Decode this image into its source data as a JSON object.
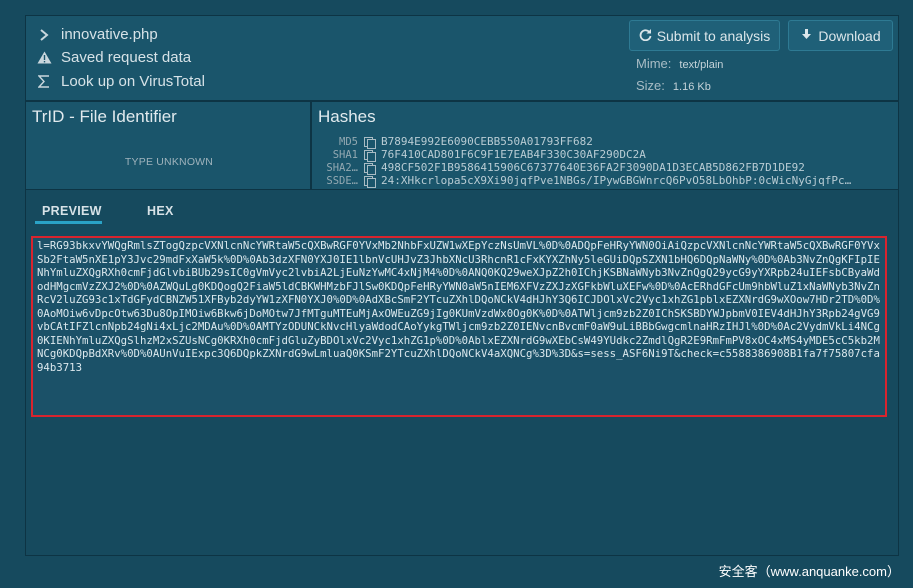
{
  "file": {
    "filename": "innovative.php",
    "saved_request": "Saved request data",
    "virustotal": "Look up on VirusTotal"
  },
  "actions": {
    "submit_label": "Submit to analysis",
    "download_label": "Download"
  },
  "meta": {
    "mime_label": "Mime:",
    "mime_value": "text/plain",
    "size_label": "Size:",
    "size_value": "1.16 Kb"
  },
  "trid": {
    "title": "TrID - File Identifier",
    "type": "TYPE UNKNOWN"
  },
  "hashes": {
    "title": "Hashes",
    "rows": [
      {
        "label": "MD5",
        "value": "B7894E992E6090CEBB550A01793FF682"
      },
      {
        "label": "SHA1",
        "value": "76F410CAD801F6C9F1E7EAB4F330C30AF290DC2A"
      },
      {
        "label": "SHA2…",
        "value": "498CF502F1B9586415906C67377640E36FA2F3090DA1D3ECAB5D862FB7D1DE92"
      },
      {
        "label": "SSDE…",
        "value": "24:XHkcrlopa5cX9Xi90jqfPve1NBGs/IPywGBGWnrcQ6PvO58LbOhbP:0cWicNyGjqfPc…"
      }
    ]
  },
  "tabs": {
    "preview": "PREVIEW",
    "hex": "HEX"
  },
  "preview_text": "l=RG93bkxvYWQgRmlsZTogQzpcVXNlcnNcYWRtaW5cQXBwRGF0YVxMb2NhbFxUZW1wXEpYczNsUmVL%0D%0ADQpFeHRyYWN0OiAiQzpcVXNlcnNcYWRtaW5cQXBwRGF0YVxSb2FtaW5nXE1pY3Jvc29mdFxXaW5k%0D%0Ab3dzXFN0YXJ0IE1lbnVcUHJvZ3JhbXNcU3RhcnR1cFxKYXZhNy5leGUiDQpSZXN1bHQ6DQpNaWNy%0D%0Ab3NvZnQgKFIpIENhYmluZXQgRXh0cmFjdGlvbiBUb29sIC0gVmVyc2lvbiA2LjEuNzYwMC4xNjM4%0D%0ANQ0KQ29weXJpZ2h0IChjKSBNaWNyb3NvZnQgQ29ycG9yYXRpb24uIEFsbCByaWdodHMgcmVzZXJ2%0D%0AZWQuLg0KDQogQ2FiaW5ldCBKWHMzbFJlSw0KDQpFeHRyYWN0aW5nIEM6XFVzZXJzXGFkbWluXEFw%0D%0AcERhdGFcUm9hbWluZ1xNaWNyb3NvZnRcV2luZG93c1xTdGFydCBNZW51XFByb2dyYW1zXFN0YXJ0%0D%0AdXBcSmF2YTcuZXhlDQoNCkV4dHJhY3Q6ICJDOlxVc2Vyc1xhZG1pblxEZXNrdG9wXOow7HDr2TD%0D%0AoMOiw6vDpcOtw63Du8OpIMOiw6Bkw6jDoMOtw7JfMTguMTEuMjAxOWEuZG9jIg0KUmVzdWx0Og0K%0D%0ATWljcm9zb2Z0IChSKSBDYWJpbmV0IEV4dHJhY3Rpb24gVG9vbCAtIFZlcnNpb24gNi4xLjc2MDAu%0D%0AMTYzODUNCkNvcHlyaWdodCAoYykgTWljcm9zb2Z0IENvcnBvcmF0aW9uLiBBbGwgcmlnaHRzIHJl%0D%0Ac2VydmVkLi4NCg0KIENhYmluZXQgSlhzM2xSZUsNCg0KRXh0cmFjdGluZyBDOlxVc2Vyc1xhZG1p%0D%0AblxEZXNrdG9wXEbCsW49YUdkc2ZmdlQgR2E9RmFmPV8xOC4xMS4yMDE5cC5kb2MNCg0KDQpBdXRv%0D%0AUnVuIExpc3Q6DQpkZXNrdG9wLmluaQ0KSmF2YTcuZXhlDQoNCkV4aXQNCg%3D%3D&s=sess_ASF6Ni9T&check=c5588386908B1fa7f75807cfa94b3713",
  "watermark": "安全客（www.anquanke.com）",
  "colors": {
    "background": "#164a5e",
    "panel": "#1a556b",
    "accent": "#2aa3c7",
    "highlight_border": "#d8242e"
  },
  "icons": {
    "filename": "chevron-right-icon",
    "saved_request": "warning-icon",
    "virustotal": "sigma-icon",
    "submit": "refresh-icon",
    "download": "download-icon",
    "hash": "copy-icon"
  }
}
